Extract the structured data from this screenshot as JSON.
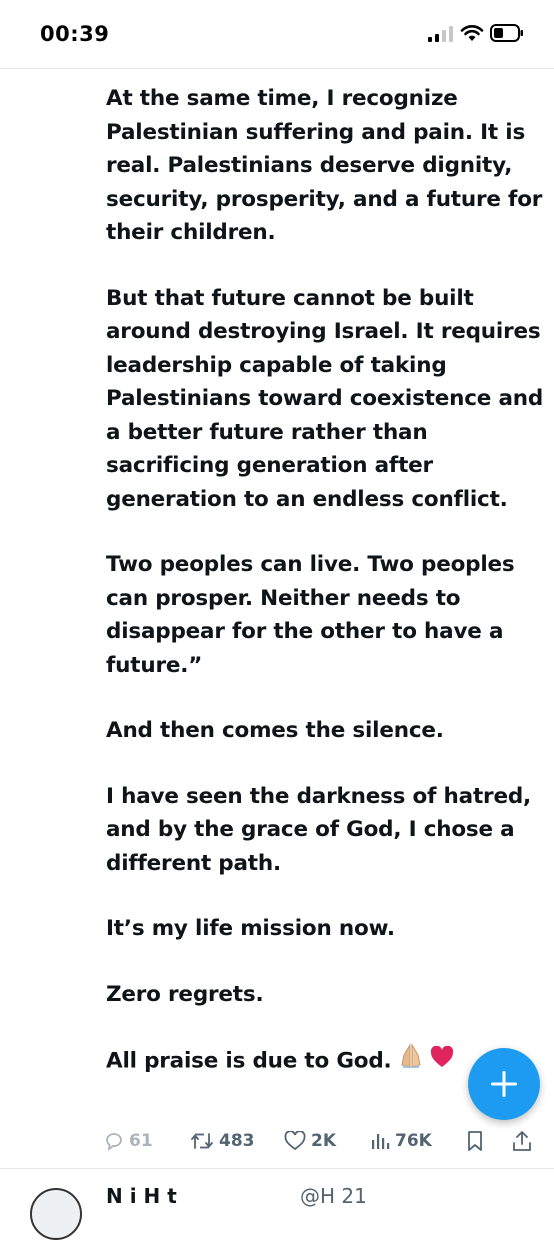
{
  "status_bar": {
    "time": "00:39",
    "signal_icon": "cellular-signal-icon",
    "wifi_icon": "wifi-icon",
    "battery_icon": "battery-icon"
  },
  "tweet": {
    "paragraphs": [
      "At the same time, I recognize Palestinian suffering and pain. It is real. Palestinians deserve dignity, security, prosperity, and a future for their children.",
      "But that future cannot be built around destroying Israel. It requires leadership capable of taking Palestinians toward coexistence and a better future rather than sacrificing generation after generation to an endless conflict.",
      "Two peoples can live. Two peoples can prosper. Neither needs to disappear for the other to have a future.”",
      "And then comes the silence.",
      "I have seen the darkness of hatred, and by the grace of God, I chose a different path.",
      "It’s my life mission now.",
      "Zero regrets.",
      "All praise is due to God."
    ],
    "closing_emojis": [
      "folded-hands-icon",
      "red-heart-icon"
    ]
  },
  "actions": {
    "replies": "61",
    "reposts": "483",
    "likes": "2K",
    "views": "76K"
  },
  "fab": {
    "icon": "plus-icon"
  },
  "next_tweet": {
    "name_partial": "N   i H   t",
    "meta_partial": "@H    21"
  },
  "colors": {
    "accent": "#1d9bf0",
    "text": "#0f1419",
    "muted": "#536471",
    "heart": "#e0245e"
  }
}
